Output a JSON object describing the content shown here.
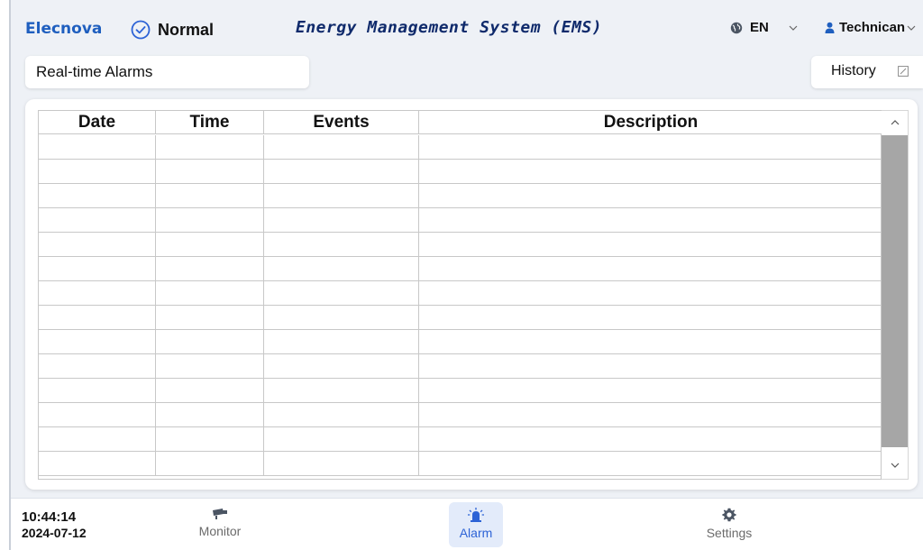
{
  "header": {
    "brand": "Elecnova",
    "status": "Normal",
    "title": "Energy Management System (EMS)",
    "language": "EN",
    "user": "Technican"
  },
  "tabs": {
    "realtime": "Real-time Alarms",
    "history": "History"
  },
  "table": {
    "columns": [
      "Date",
      "Time",
      "Events",
      "Description"
    ],
    "rows": [
      [],
      [],
      [],
      [],
      [],
      [],
      [],
      [],
      [],
      [],
      [],
      [],
      [],
      []
    ]
  },
  "footer": {
    "time": "10:44:14",
    "date": "2024-07-12",
    "nav": {
      "monitor": "Monitor",
      "alarm": "Alarm",
      "settings": "Settings"
    },
    "active": "alarm"
  },
  "colors": {
    "brand": "#1f5fbf",
    "title": "#0f2a6b",
    "status_ok": "#2d63d6",
    "active_nav": "#2d63d6",
    "scroll_thumb": "#a6a6a6"
  },
  "icons": {
    "status": "check-circle-icon",
    "language": "globe-icon",
    "user": "person-icon",
    "history": "edit-square-icon",
    "monitor": "camera-icon",
    "alarm": "siren-icon",
    "settings": "gear-icon"
  }
}
